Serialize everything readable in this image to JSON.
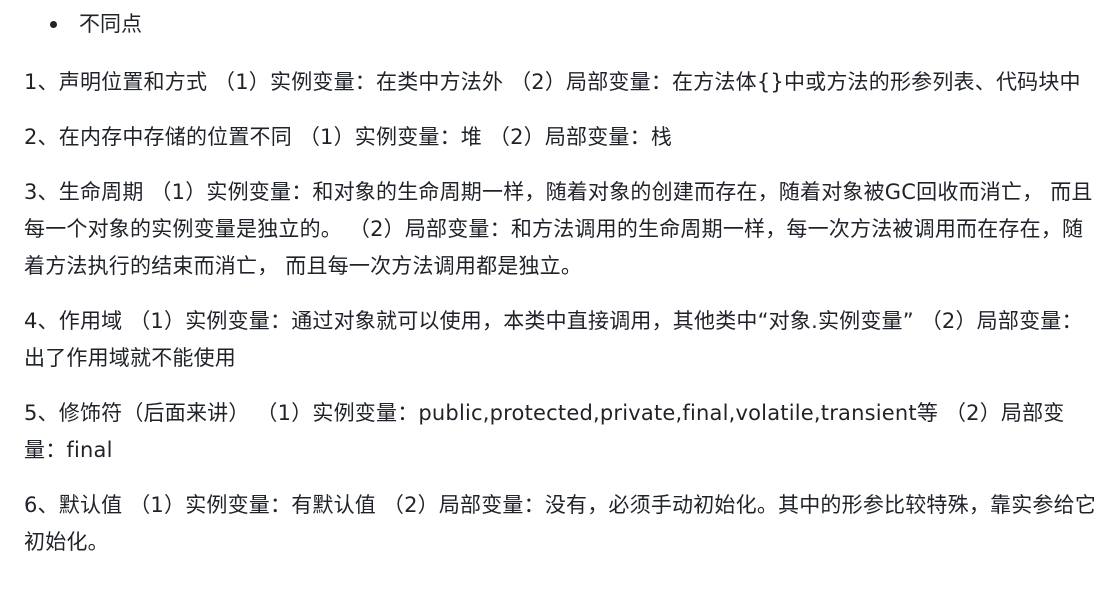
{
  "heading": "不同点",
  "paragraphs": [
    "1、声明位置和方式 （1）实例变量：在类中方法外 （2）局部变量：在方法体{}中或方法的形参列表、代码块中",
    "2、在内存中存储的位置不同 （1）实例变量：堆 （2）局部变量：栈",
    "3、生命周期 （1）实例变量：和对象的生命周期一样，随着对象的创建而存在，随着对象被GC回收而消亡， 而且每一个对象的实例变量是独立的。 （2）局部变量：和方法调用的生命周期一样，每一次方法被调用而在存在，随着方法执行的结束而消亡， 而且每一次方法调用都是独立。",
    "4、作用域 （1）实例变量：通过对象就可以使用，本类中直接调用，其他类中“对象.实例变量” （2）局部变量：出了作用域就不能使用",
    "5、修饰符（后面来讲） （1）实例变量：public,protected,private,final,volatile,transient等 （2）局部变量：final",
    "6、默认值 （1）实例变量：有默认值 （2）局部变量：没有，必须手动初始化。其中的形参比较特殊，靠实参给它初始化。"
  ]
}
